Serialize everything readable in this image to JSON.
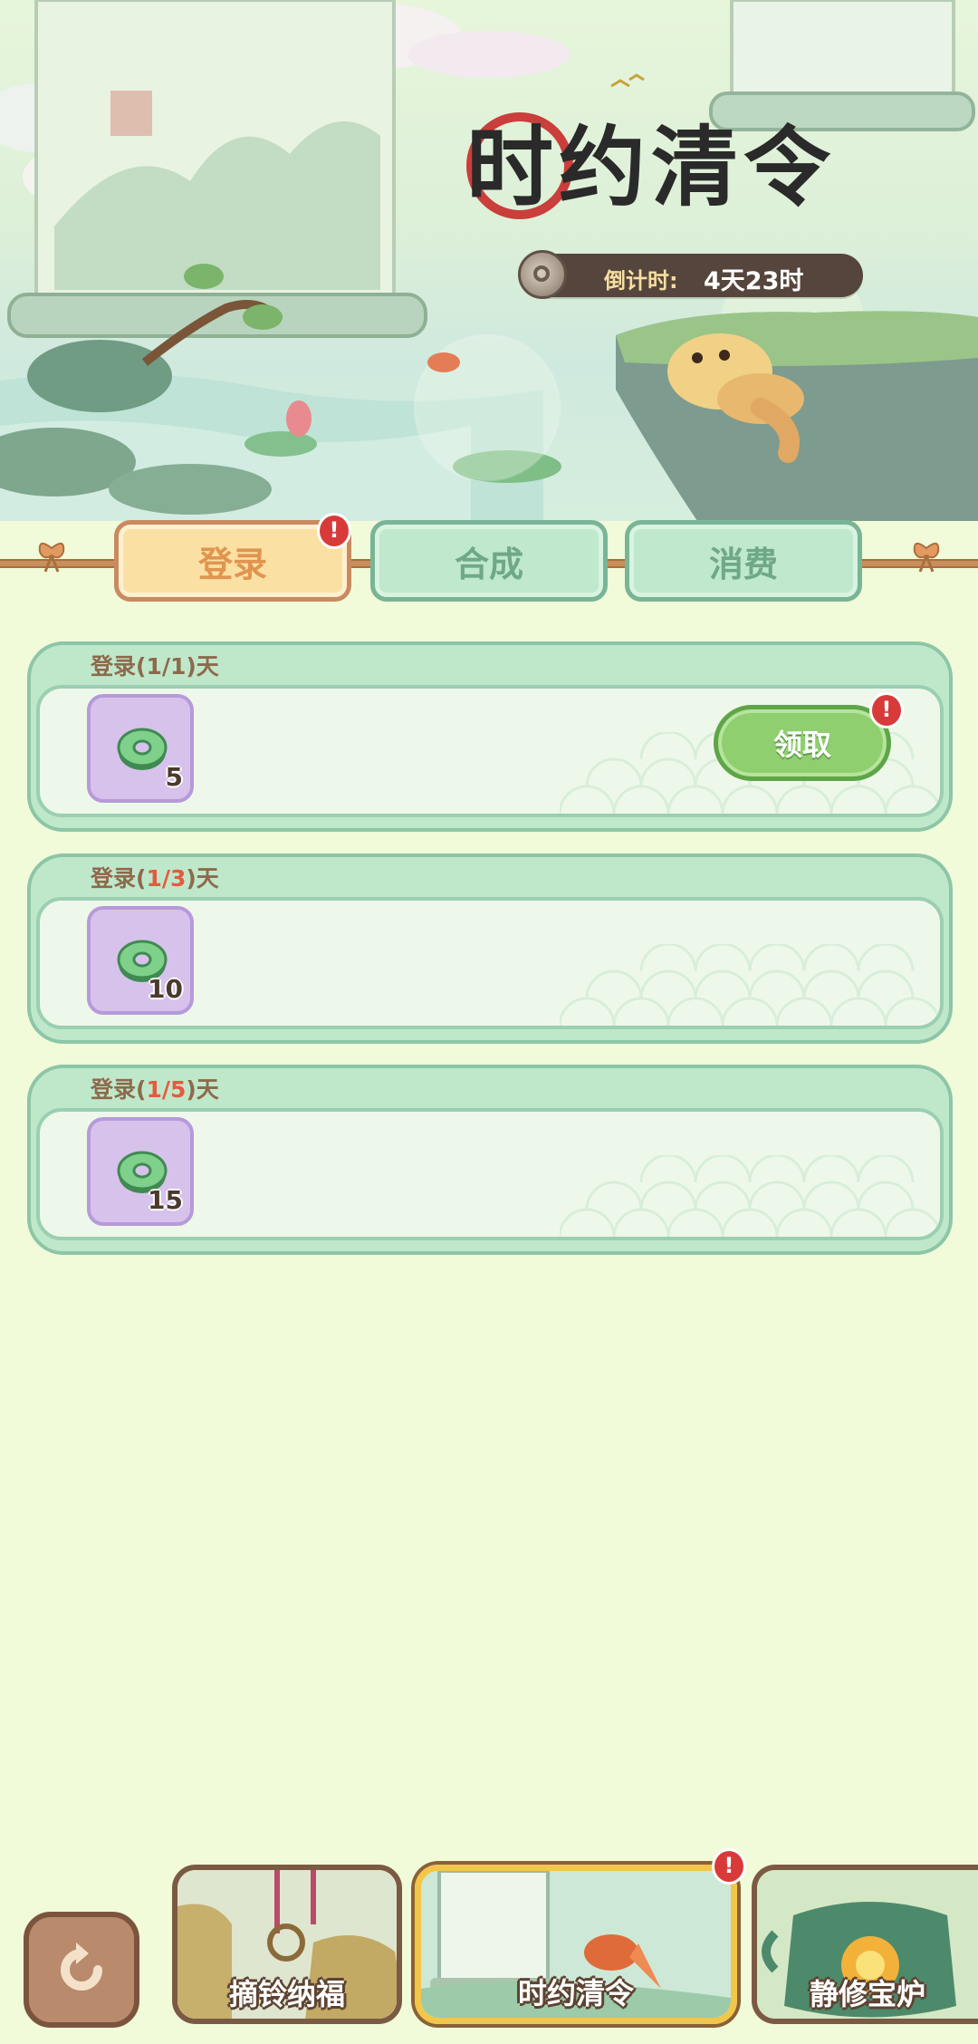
{
  "event": {
    "title": "时约清令",
    "countdown_label": "倒计时:",
    "countdown_value": "4天23时"
  },
  "tabs": [
    {
      "label": "登录",
      "active": true,
      "badge": "!"
    },
    {
      "label": "合成",
      "active": false
    },
    {
      "label": "消费",
      "active": false
    }
  ],
  "tasks": [
    {
      "header_prefix": "登录(",
      "progress": "1/1",
      "header_suffix": ")天",
      "item_icon": "jade-coin-icon",
      "quantity": "5",
      "button_label": "领取",
      "badge": "!"
    },
    {
      "header_prefix": "登录(",
      "progress": "1/3",
      "header_suffix": ")天",
      "item_icon": "jade-coin-icon",
      "quantity": "10"
    },
    {
      "header_prefix": "登录(",
      "progress": "1/5",
      "header_suffix": ")天",
      "item_icon": "jade-coin-icon",
      "quantity": "15"
    }
  ],
  "bottom_nav": [
    {
      "label": "摘铃纳福",
      "active": false
    },
    {
      "label": "时约清令",
      "active": true,
      "badge": "!"
    },
    {
      "label": "静修宝炉",
      "active": false
    }
  ],
  "colors": {
    "background": "#f1fad9",
    "tab_active": "#fbe0a4",
    "tab_inactive": "#bfe8cd",
    "claim_button": "#8fcf6f",
    "badge": "#d83a3a",
    "highlight_progress": "#e55a3f"
  }
}
